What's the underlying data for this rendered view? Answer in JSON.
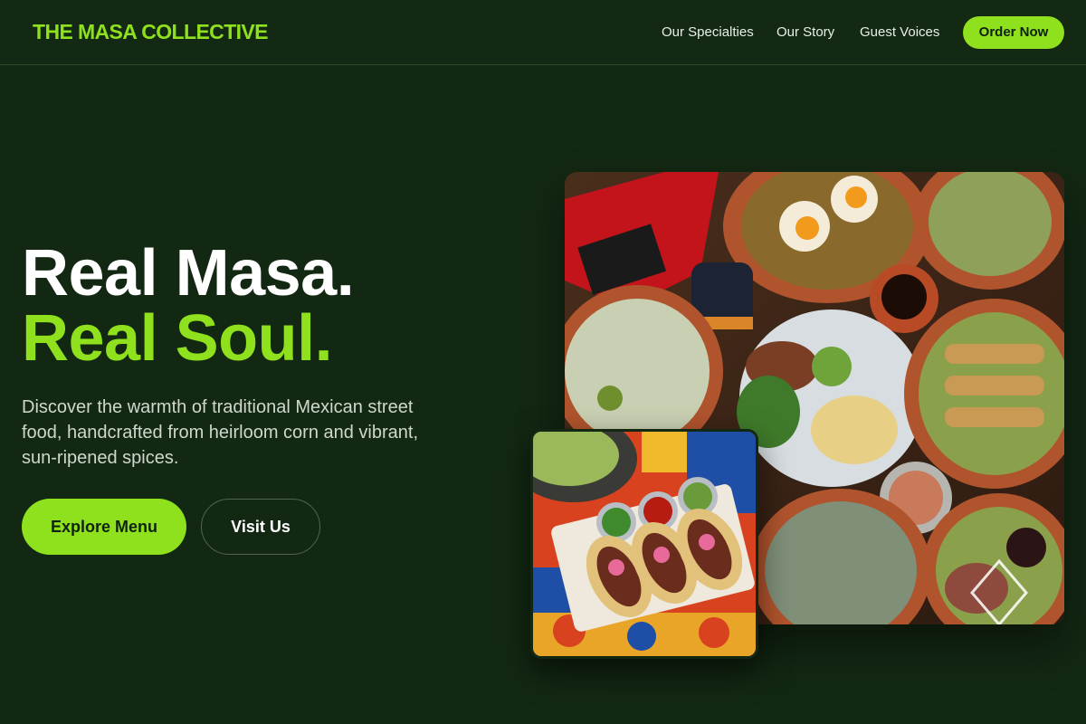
{
  "brand": {
    "name": "THE MASA COLLECTIVE"
  },
  "nav": {
    "items": [
      {
        "label": "Our Specialties"
      },
      {
        "label": "Our Story"
      },
      {
        "label": "Guest Voices"
      }
    ],
    "cta_label": "Order Now"
  },
  "hero": {
    "headline_line1": "Real Masa.",
    "headline_line2": "Real Soul.",
    "description": "Discover the warmth of traditional Mexican street food, handcrafted from heirloom corn and vibrant, sun-ripened spices.",
    "primary_button": "Explore Menu",
    "secondary_button": "Visit Us"
  },
  "images": {
    "main": {
      "subject": "overhead-mexican-feast-photo"
    },
    "secondary": {
      "subject": "tacos-with-salsas-photo"
    }
  },
  "colors": {
    "background": "#132813",
    "accent": "#8ee11c",
    "text": "#ffffff",
    "muted_text": "#cfd8cb"
  }
}
